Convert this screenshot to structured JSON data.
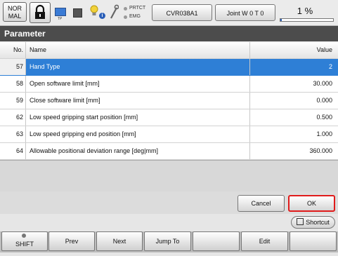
{
  "status": {
    "mode_line1": "NOR",
    "mode_line2": "MAL",
    "tp_label": "TP",
    "protect_label": "PRTCT",
    "emg_label": "EMG",
    "program_label": "CVR038A1",
    "jog_mode_label": "Joint  W 0 T 0",
    "speed_text": "1 %",
    "speed_percent": 1,
    "icons": [
      "lock-icon",
      "teach-pendant-icon",
      "stop-icon",
      "lamp-icon",
      "info-icon",
      "wrench-icon"
    ]
  },
  "title": "Parameter",
  "table": {
    "columns": {
      "no": "No.",
      "name": "Name",
      "value": "Value"
    },
    "rows": [
      {
        "no": "57",
        "name": "Hand Type",
        "value": "2",
        "selected": true
      },
      {
        "no": "58",
        "name": "Open software limit [mm]",
        "value": "30.000"
      },
      {
        "no": "59",
        "name": "Close software limit [mm]",
        "value": "0.000"
      },
      {
        "no": "62",
        "name": "Low speed gripping start position [mm]",
        "value": "0.500"
      },
      {
        "no": "63",
        "name": "Low speed gripping end position [mm]",
        "value": "1.000"
      },
      {
        "no": "64",
        "name": "Allowable positional deviation range [deg|mm]",
        "value": "360.000"
      }
    ]
  },
  "buttons": {
    "cancel": "Cancel",
    "ok": "OK",
    "shortcut": "Shortcut"
  },
  "fkeys": [
    "SHIFT",
    "Prev",
    "Next",
    "Jump To",
    "",
    "Edit",
    ""
  ],
  "colors": {
    "selected_row": "#2e7fd6",
    "title_bar": "#4c4c4c",
    "ok_border": "#e01b1b"
  }
}
